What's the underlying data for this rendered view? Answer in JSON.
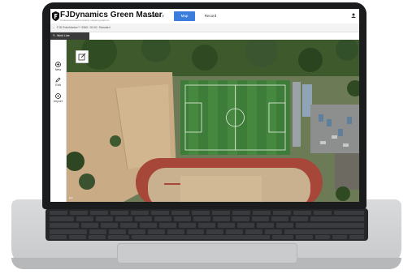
{
  "app": {
    "brand": "FJDynamics Green Master",
    "brand_tagline": "Professional field boundary mapping platform"
  },
  "nav": {
    "items": [
      {
        "label": "Device ∨"
      },
      {
        "label": "Map",
        "active": true
      },
      {
        "label": "Record"
      }
    ],
    "accent_color": "#3b7ddd"
  },
  "breadcrumb": {
    "back_icon": "arrow-left-icon",
    "text": "FJD RoboMarker™ S960 / SLV6 / Standard"
  },
  "work_tab": {
    "label": "Work Line",
    "icon": "pencil-icon"
  },
  "tools": [
    {
      "label": "New",
      "icon": "plus-circle-icon"
    },
    {
      "label": "Edit",
      "icon": "pencil-icon"
    },
    {
      "label": "Import",
      "icon": "import-circle-icon"
    }
  ],
  "map": {
    "type": "satellite",
    "credit": "Esri"
  }
}
